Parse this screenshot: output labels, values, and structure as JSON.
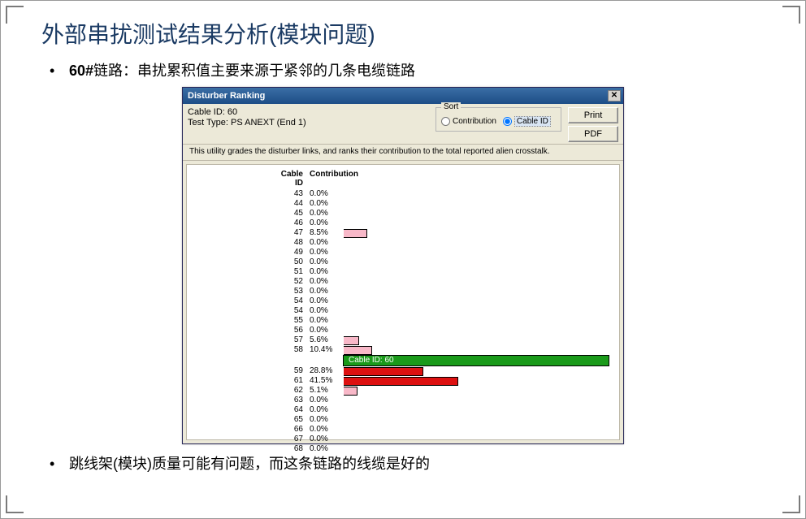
{
  "slide": {
    "title": "外部串扰测试结果分析(模块问题)",
    "bullet1_prefix": "60#",
    "bullet1_text": "链路：串扰累积值主要来源于紧邻的几条电缆链路",
    "bullet2": "跳线架(模块)质量可能有问题，而这条链路的线缆是好的"
  },
  "dialog": {
    "title": "Disturber Ranking",
    "cable_id_label": "Cable ID: 60",
    "test_type": "Test Type: PS ANEXT (End 1)",
    "sort_label": "Sort",
    "radio_contribution": "Contribution",
    "radio_cableid": "Cable ID",
    "btn_print": "Print",
    "btn_pdf": "PDF",
    "description": "This utility grades the disturber links, and ranks their contribution to the total reported alien crosstalk.",
    "col_cableid": "Cable ID",
    "col_contribution": "Contribution",
    "highlight_label": "Cable ID: 60",
    "close_x": "✕"
  },
  "chart_data": {
    "type": "bar",
    "xlabel": "Contribution",
    "ylabel": "Cable ID",
    "highlight_cable": 60,
    "highlight_after_index": 16,
    "rows": [
      {
        "id": "43",
        "pct": "0.0%",
        "value": 0.0,
        "red": false
      },
      {
        "id": "44",
        "pct": "0.0%",
        "value": 0.0,
        "red": false
      },
      {
        "id": "45",
        "pct": "0.0%",
        "value": 0.0,
        "red": false
      },
      {
        "id": "46",
        "pct": "0.0%",
        "value": 0.0,
        "red": false
      },
      {
        "id": "47",
        "pct": "8.5%",
        "value": 8.5,
        "red": false
      },
      {
        "id": "48",
        "pct": "0.0%",
        "value": 0.0,
        "red": false
      },
      {
        "id": "49",
        "pct": "0.0%",
        "value": 0.0,
        "red": false
      },
      {
        "id": "50",
        "pct": "0.0%",
        "value": 0.0,
        "red": false
      },
      {
        "id": "51",
        "pct": "0.0%",
        "value": 0.0,
        "red": false
      },
      {
        "id": "52",
        "pct": "0.0%",
        "value": 0.0,
        "red": false
      },
      {
        "id": "53",
        "pct": "0.0%",
        "value": 0.0,
        "red": false
      },
      {
        "id": "54",
        "pct": "0.0%",
        "value": 0.0,
        "red": false
      },
      {
        "id": "54",
        "pct": "0.0%",
        "value": 0.0,
        "red": false
      },
      {
        "id": "55",
        "pct": "0.0%",
        "value": 0.0,
        "red": false
      },
      {
        "id": "56",
        "pct": "0.0%",
        "value": 0.0,
        "red": false
      },
      {
        "id": "57",
        "pct": "5.6%",
        "value": 5.6,
        "red": false
      },
      {
        "id": "58",
        "pct": "10.4%",
        "value": 10.4,
        "red": false
      },
      {
        "id": "59",
        "pct": "28.8%",
        "value": 28.8,
        "red": true
      },
      {
        "id": "61",
        "pct": "41.5%",
        "value": 41.5,
        "red": true
      },
      {
        "id": "62",
        "pct": "5.1%",
        "value": 5.1,
        "red": false
      },
      {
        "id": "63",
        "pct": "0.0%",
        "value": 0.0,
        "red": false
      },
      {
        "id": "64",
        "pct": "0.0%",
        "value": 0.0,
        "red": false
      },
      {
        "id": "65",
        "pct": "0.0%",
        "value": 0.0,
        "red": false
      },
      {
        "id": "66",
        "pct": "0.0%",
        "value": 0.0,
        "red": false
      },
      {
        "id": "67",
        "pct": "0.0%",
        "value": 0.0,
        "red": false
      },
      {
        "id": "68",
        "pct": "0.0%",
        "value": 0.0,
        "red": false
      }
    ]
  }
}
